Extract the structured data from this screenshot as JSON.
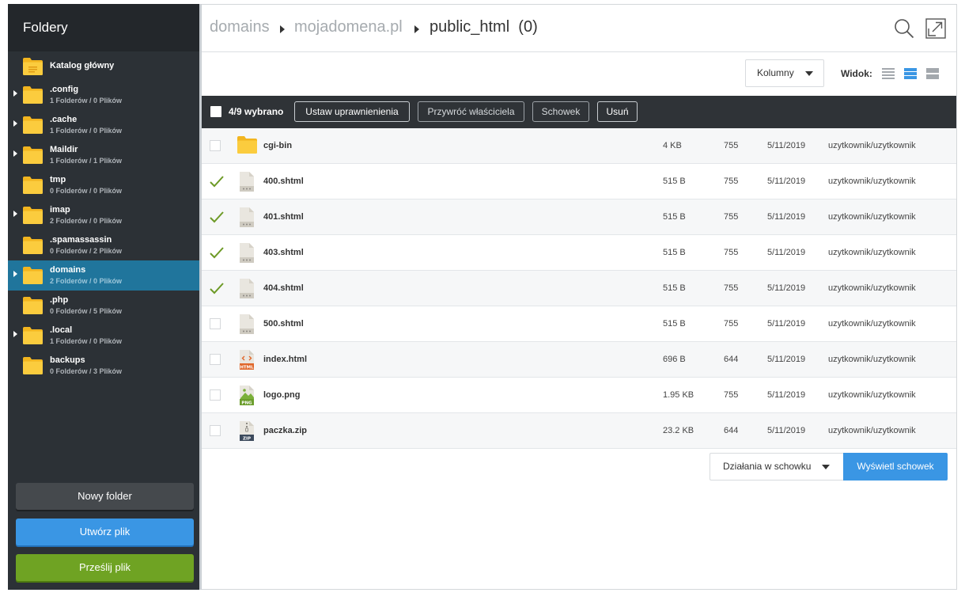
{
  "sidebar": {
    "title": "Foldery",
    "folders": [
      {
        "name": "Katalog główny",
        "meta": "",
        "expandable": false
      },
      {
        "name": ".config",
        "meta": "1 Folderów / 0 Plików",
        "expandable": true
      },
      {
        "name": ".cache",
        "meta": "1 Folderów / 0 Plików",
        "expandable": true
      },
      {
        "name": "Maildir",
        "meta": "1 Folderów / 1 Plików",
        "expandable": true
      },
      {
        "name": "tmp",
        "meta": "0 Folderów / 0 Plików",
        "expandable": false
      },
      {
        "name": "imap",
        "meta": "2 Folderów / 0 Plików",
        "expandable": true
      },
      {
        "name": ".spamassassin",
        "meta": "0 Folderów / 2 Plików",
        "expandable": false
      },
      {
        "name": "domains",
        "meta": "2 Folderów / 0 Plików",
        "expandable": true,
        "active": true
      },
      {
        "name": ".php",
        "meta": "0 Folderów / 5 Plików",
        "expandable": false
      },
      {
        "name": ".local",
        "meta": "1 Folderów / 0 Plików",
        "expandable": true
      },
      {
        "name": "backups",
        "meta": "0 Folderów / 3 Plików",
        "expandable": false
      }
    ],
    "new_folder_label": "Nowy folder",
    "create_file_label": "Utwórz plik",
    "upload_label": "Prześlij plik"
  },
  "breadcrumb": {
    "items": [
      "domains",
      "mojadomena.pl"
    ],
    "current": "public_html",
    "count": "(0)"
  },
  "toolbar": {
    "columns_label": "Kolumny",
    "view_label": "Widok:",
    "view_icons": [
      "list-compact-icon",
      "list-medium-icon",
      "list-large-icon"
    ],
    "active_view": 1
  },
  "selection": {
    "count_label": "4/9 wybrano",
    "set_permissions": "Ustaw uprawnienienia",
    "restore_owner": "Przywróć właściciela",
    "clipboard": "Schowek",
    "delete": "Usuń"
  },
  "files": [
    {
      "name": "cgi-bin",
      "type": "folder",
      "size": "4 KB",
      "perm": "755",
      "date": "5/11/2019",
      "owner": "uzytkownik/uzytkownik",
      "checked": false
    },
    {
      "name": "400.shtml",
      "type": "generic",
      "size": "515 B",
      "perm": "755",
      "date": "5/11/2019",
      "owner": "uzytkownik/uzytkownik",
      "checked": true
    },
    {
      "name": "401.shtml",
      "type": "generic",
      "size": "515 B",
      "perm": "755",
      "date": "5/11/2019",
      "owner": "uzytkownik/uzytkownik",
      "checked": true
    },
    {
      "name": "403.shtml",
      "type": "generic",
      "size": "515 B",
      "perm": "755",
      "date": "5/11/2019",
      "owner": "uzytkownik/uzytkownik",
      "checked": true
    },
    {
      "name": "404.shtml",
      "type": "generic",
      "size": "515 B",
      "perm": "755",
      "date": "5/11/2019",
      "owner": "uzytkownik/uzytkownik",
      "checked": true
    },
    {
      "name": "500.shtml",
      "type": "generic",
      "size": "515 B",
      "perm": "755",
      "date": "5/11/2019",
      "owner": "uzytkownik/uzytkownik",
      "checked": false
    },
    {
      "name": "index.html",
      "type": "html",
      "badge": "HTML",
      "size": "696 B",
      "perm": "644",
      "date": "5/11/2019",
      "owner": "uzytkownik/uzytkownik",
      "checked": false
    },
    {
      "name": "logo.png",
      "type": "png",
      "badge": "PNG",
      "size": "1.95 KB",
      "perm": "755",
      "date": "5/11/2019",
      "owner": "uzytkownik/uzytkownik",
      "checked": false
    },
    {
      "name": "paczka.zip",
      "type": "zip",
      "badge": "ZIP",
      "size": "23.2 KB",
      "perm": "644",
      "date": "5/11/2019",
      "owner": "uzytkownik/uzytkownik",
      "checked": false
    }
  ],
  "clipboard_bar": {
    "actions_label": "Działania w schowku",
    "show_label": "Wyświetl schowek"
  },
  "colors": {
    "sidebar_bg": "#2c3136",
    "active_folder": "#20759c",
    "folder_yellow": "#f7c534",
    "primary_blue": "#3a96e4",
    "upload_green": "#6fa323",
    "check_green": "#6d9a26"
  }
}
